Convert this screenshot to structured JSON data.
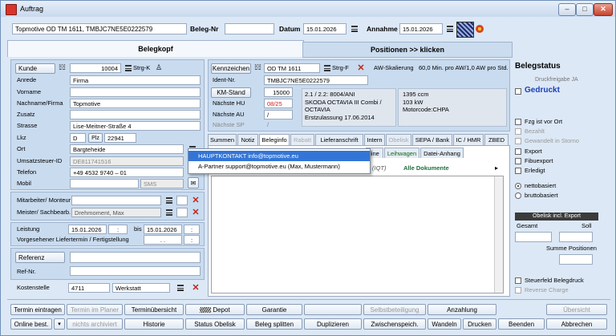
{
  "window": {
    "title": "Auftrag",
    "min": "‒",
    "max": "□",
    "close": "✕"
  },
  "header": {
    "vehicle_field": "Topmotive OD TM 1611, TMBJC7NE5E0222579",
    "beleg_nr_label": "Beleg-Nr",
    "beleg_nr_value": "",
    "datum_label": "Datum",
    "datum_value": "15.01.2026",
    "annahme_label": "Annahme",
    "annahme_value": "15.01.2026"
  },
  "main_tabs": {
    "belegkopf": "Belegkopf",
    "positionen": "Positionen >> klicken"
  },
  "customer": {
    "kunde_btn": "Kunde",
    "kunde_nr": "10004",
    "strg_k": "Strg-K",
    "anrede_label": "Anrede",
    "anrede": "Firma",
    "vorname_label": "Vorname",
    "vorname": "",
    "nachname_label": "Nachname/Firma",
    "nachname": "Topmotive",
    "zusatz_label": "Zusatz",
    "zusatz": "",
    "strasse_label": "Strasse",
    "strasse": "Lise-Meitner-Straße 4",
    "lkz_label": "Lkz",
    "lkz": "D",
    "plz_label": "Plz",
    "plz": "22941",
    "ort_label": "Ort",
    "ort": "Bargteheide",
    "ust_label": "Umsatzsteuer-ID",
    "ust": "DE811741516",
    "telefon_label": "Telefon",
    "telefon": "+49 4532 9740 – 01",
    "mobil_label": "Mobil",
    "mobil": "",
    "sms": "SMS"
  },
  "staff": {
    "mitarbeiter_label": "Mitarbeiter/ Monteur",
    "mitarbeiter": "",
    "meister_label": "Meister/ Sachbearb.",
    "meister": "Drehmoment, Max"
  },
  "leistung": {
    "label": "Leistung",
    "from": "15.01.2026",
    "from_sep": ":",
    "bis_label": "bis",
    "to": "15.01.2026",
    "to_sep": ":",
    "liefertermin_label": "Vorgesehener Liefertermin / Fertigstellung",
    "liefertermin": ". .",
    "liefertermin_sep": ":"
  },
  "referenz": {
    "btn": "Referenz",
    "value": "",
    "ref_nr_label": "Ref-Nr.",
    "ref_nr": ""
  },
  "kostenstelle": {
    "label": "Kostenstelle",
    "value": "4711",
    "werkstatt": "Werkstatt"
  },
  "vehicle": {
    "kennzeichen_btn": "Kennzeichen",
    "kennzeichen": "OD TM 1611",
    "strg_f": "Strg-F",
    "aw_skalierung": "AW-Skalierung",
    "aw_info": "60,0 Min. pro AW/1,0 AW pro Std.",
    "ident_label": "Ident-Nr.",
    "ident": "TMBJC7NE5E0222579",
    "km_btn": "KM-Stand",
    "km": "15000",
    "hu_label": "Nächste HU",
    "hu": "08/25",
    "au_label": "Nächste AU",
    "au": "/",
    "sp_label": "Nächste SP",
    "sp": "/",
    "desc_lines": [
      "2.1 / 2.2: 8004/ANI",
      "SKODA OCTAVIA III Combi /",
      "OCTAVIA",
      "Erstzulassung 17.06.2014"
    ],
    "specs_lines": [
      "1395 ccm",
      "103 kW",
      "Motorcode:CHPA"
    ]
  },
  "tabs": [
    "Summen",
    "Notiz",
    "Beleginfo",
    "Rabatt",
    "Lieferanschrift",
    "Intern",
    "Obelisk",
    "SEPA / Bank",
    "IC / HMR",
    "ZBED"
  ],
  "subtabs": [
    "line",
    "Leihwagen",
    "Datei-Anhang"
  ],
  "iqt": "(IQT)",
  "alle_dokumente": "Alle Dokumente",
  "popup": {
    "item1": "HAUPTKONTAKT info@topmotive.eu",
    "item2": "A-Partner support@topmotive.eu (Max, Mustermann)"
  },
  "status": {
    "title": "Belegstatus",
    "druckfreigabe": "Druckfreigabe JA",
    "gedruckt": "Gedruckt",
    "checks": [
      {
        "label": "Fzg ist vor Ort",
        "disabled": false
      },
      {
        "label": "Bezahlt",
        "disabled": true
      },
      {
        "label": "Gewandelt in Storno",
        "disabled": true
      },
      {
        "label": "Export",
        "disabled": false
      },
      {
        "label": "Fibuexport",
        "disabled": false
      },
      {
        "label": "Erledigt",
        "disabled": false
      }
    ],
    "netto": "nettobasiert",
    "brutto": "bruttobasiert",
    "obelisk_export": "Obelisk incl. Export",
    "gesamt": "Gesamt",
    "soll": "Soll",
    "summe_positionen": "Summe Positionen",
    "steuerfeld": "Steuerfeld Belegdruck",
    "reverse_charge": "Reverse Charge"
  },
  "bottom_row1": {
    "termin_eintragen": "Termin eintragen",
    "termin_im_planer": "Termin im Planer",
    "terminuebersicht": "Terminübersicht",
    "depot": "Depot",
    "garantie": "Garantie",
    "selbstbeteiligung": "Selbstbeteiligung",
    "anzahlung": "Anzahlung",
    "uebersicht": "Übersicht"
  },
  "bottom_row2": {
    "online_best": "Online best.",
    "nichts_archiviert": "nichts archiviert",
    "historie": "Historie",
    "status_obelisk": "Status Obelisk",
    "beleg_splitten": "Beleg splitten",
    "duplizieren": "Duplizieren",
    "zwischenspeich": "Zwischenspeich.",
    "wandeln": "Wandeln",
    "drucken": "Drucken",
    "beenden": "Beenden",
    "abbrechen": "Abbrechen"
  }
}
